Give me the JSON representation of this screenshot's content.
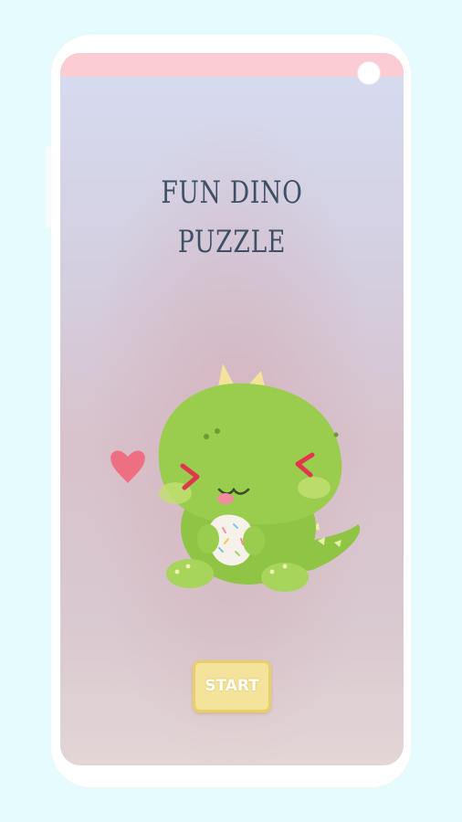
{
  "game": {
    "title_line1": "FUN DINO",
    "title_line2": "PUZZLE",
    "start_label": "START"
  },
  "colors": {
    "background": "#e6fbfd",
    "status_bar": "#fbcdd2",
    "title": "#3f5066",
    "dino_body": "#9acd4e",
    "heart": "#ee6f82",
    "start_button": "#f4e49b"
  },
  "icons": [
    "camera-dot",
    "heart-icon",
    "dino-illustration"
  ]
}
